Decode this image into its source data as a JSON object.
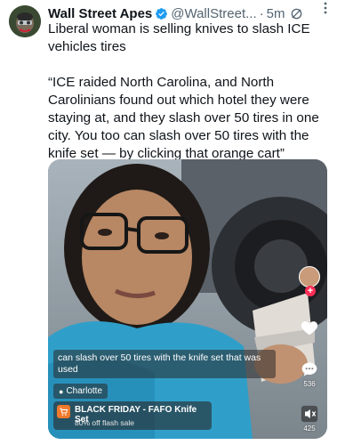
{
  "author": {
    "display_name": "Wall Street Apes",
    "handle": "@WallStreet...",
    "separator": "·",
    "time": "5m"
  },
  "tweet": {
    "line1": "Liberal woman is selling knives to slash ICE vehicles tires",
    "quote": "“ICE raided North Carolina, and North Carolinians found out which hotel they were staying at, and they slash over 50 tires in one city. You too can slash over 50 tires with the knife set — by clicking that orange cart”"
  },
  "video": {
    "caption": "can slash over 50 tires with the knife set that was used",
    "location": "Charlotte",
    "shop_title": "BLACK FRIDAY - FAFO Knife Set",
    "shop_sub": "80% off flash sale",
    "likes": "536",
    "shares": "425",
    "follow_plus": "+"
  },
  "colors": {
    "verified": "#1d9bf0",
    "cart": "#f07a2c",
    "follow": "#fe2c55"
  },
  "icons": [
    "verified-badge-icon",
    "grok-icon",
    "more-icon",
    "location-pin-icon",
    "cart-icon",
    "heart-icon",
    "comment-icon",
    "share-icon",
    "volume-icon"
  ]
}
